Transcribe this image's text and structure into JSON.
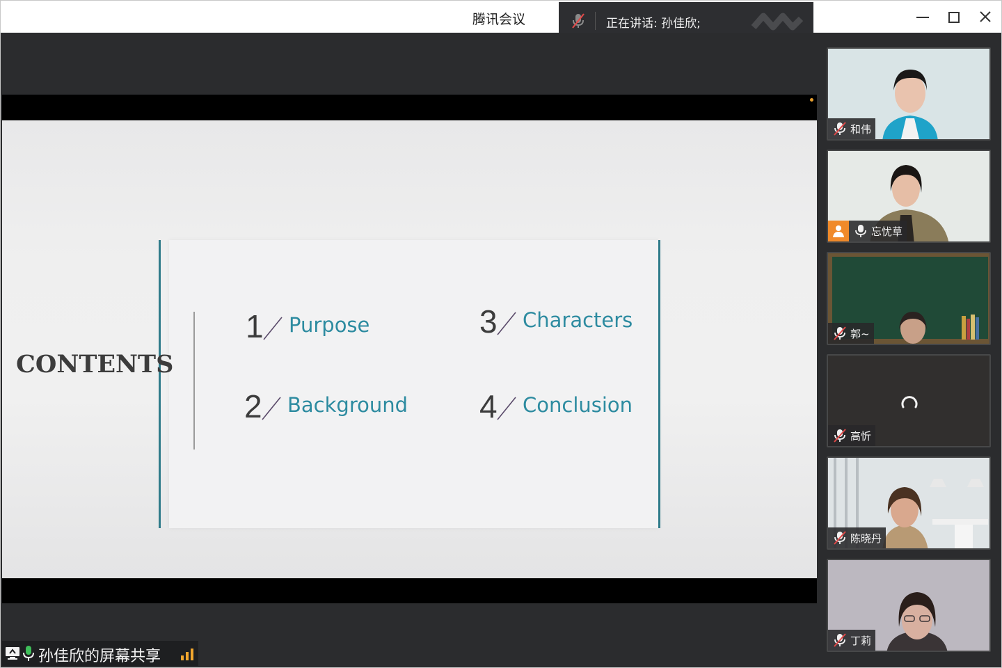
{
  "window": {
    "app_title": "腾讯会议",
    "speaking_text": "正在讲话: 孙佳欣;"
  },
  "slide": {
    "contents_title": "CONTENTS",
    "items": [
      {
        "num": "1",
        "label": "Purpose"
      },
      {
        "num": "2",
        "label": "Background"
      },
      {
        "num": "3",
        "label": "Characters"
      },
      {
        "num": "4",
        "label": "Conclusion"
      }
    ],
    "colors": {
      "accent": "#2f7b8a",
      "label": "#2d8ba0",
      "slash": "#5a4a6a"
    }
  },
  "share_status": {
    "text": "孙佳欣的屏幕共享",
    "signal_color": "#f2a72e"
  },
  "participants": [
    {
      "name": "和伟",
      "mic": "muted-mic-icon"
    },
    {
      "name": "忘忧草",
      "mic": "mic-icon",
      "avatar_icon": "person-icon"
    },
    {
      "name": "郭~",
      "mic": "muted-mic-icon"
    },
    {
      "name": "高忻",
      "mic": "muted-mic-icon",
      "state": "loading-spinner-icon"
    },
    {
      "name": "陈晓丹",
      "mic": "muted-mic-icon"
    },
    {
      "name": "丁莉",
      "mic": "muted-mic-icon"
    }
  ]
}
